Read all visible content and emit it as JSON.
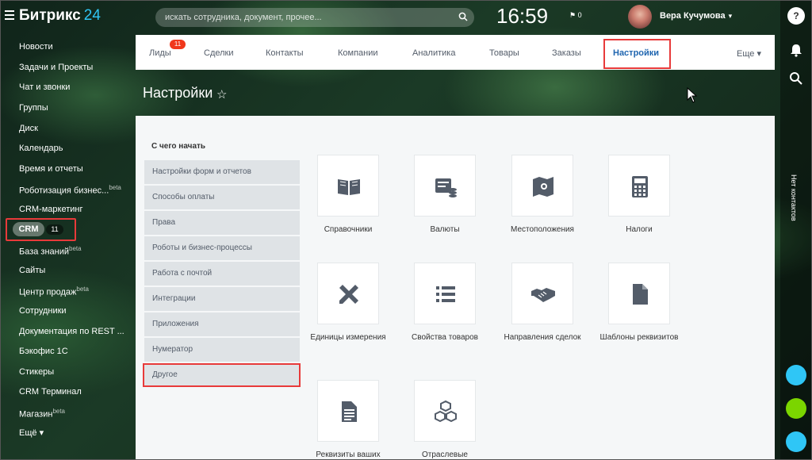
{
  "header": {
    "app_name": "Битрикс",
    "app_version": "24",
    "search_placeholder": "искать сотрудника, документ, прочее...",
    "time": "16:59",
    "flag_count": "0",
    "user_name": "Вера Кучумова"
  },
  "sidebar": {
    "items": [
      {
        "label": "Новости",
        "sup": ""
      },
      {
        "label": "Задачи и Проекты",
        "sup": ""
      },
      {
        "label": "Чат и звонки",
        "sup": ""
      },
      {
        "label": "Группы",
        "sup": ""
      },
      {
        "label": "Диск",
        "sup": ""
      },
      {
        "label": "Календарь",
        "sup": ""
      },
      {
        "label": "Время и отчеты",
        "sup": ""
      },
      {
        "label": "Роботизация бизнес...",
        "sup": "beta"
      },
      {
        "label": "CRM-маркетинг",
        "sup": ""
      },
      {
        "label": "",
        "sup": ""
      },
      {
        "label": "База знаний",
        "sup": "beta"
      },
      {
        "label": "Сайты",
        "sup": ""
      },
      {
        "label": "Центр продаж",
        "sup": "beta"
      },
      {
        "label": "Сотрудники",
        "sup": ""
      },
      {
        "label": "Документация по REST ...",
        "sup": ""
      },
      {
        "label": "Бэкофис 1С",
        "sup": ""
      },
      {
        "label": "Стикеры",
        "sup": ""
      },
      {
        "label": "CRM Терминал",
        "sup": ""
      },
      {
        "label": "Магазин",
        "sup": "beta"
      },
      {
        "label": "Ещё",
        "sup": ""
      }
    ],
    "crm": {
      "label": "CRM",
      "count": "11"
    }
  },
  "tabs": {
    "items": [
      "Лиды",
      "Сделки",
      "Контакты",
      "Компании",
      "Аналитика",
      "Товары",
      "Заказы",
      "Настройки",
      "Еще"
    ],
    "leads_badge": "11",
    "active": "Настройки"
  },
  "page": {
    "title": "Настройки"
  },
  "settings": {
    "section_title": "С чего начать",
    "nav": [
      "Настройки форм и отчетов",
      "Способы оплаты",
      "Права",
      "Роботы и бизнес-процессы",
      "Работа с почтой",
      "Интеграции",
      "Приложения",
      "Нумератор",
      "Другое"
    ],
    "tiles": [
      {
        "label": "Справочники",
        "icon": "book-icon"
      },
      {
        "label": "Валюты",
        "icon": "currency-icon"
      },
      {
        "label": "Местоположения",
        "icon": "map-icon"
      },
      {
        "label": "Налоги",
        "icon": "calculator-icon"
      },
      {
        "label": "Единицы измерения",
        "icon": "ruler-pencil-icon"
      },
      {
        "label": "Свойства товаров",
        "icon": "list-icon"
      },
      {
        "label": "Направления сделок",
        "icon": "handshake-icon"
      },
      {
        "label": "Шаблоны реквизитов",
        "icon": "document-icon"
      },
      {
        "label": "Реквизиты ваших",
        "icon": "text-document-icon"
      },
      {
        "label": "Отраслевые",
        "icon": "cubes-icon"
      }
    ]
  },
  "right_rail": {
    "no_contacts": "Нет контактов"
  },
  "colors": {
    "accent": "#2fc6f6",
    "active_tab": "#2066b0",
    "highlight": "#e83a3a",
    "badge": "#f0371b"
  }
}
